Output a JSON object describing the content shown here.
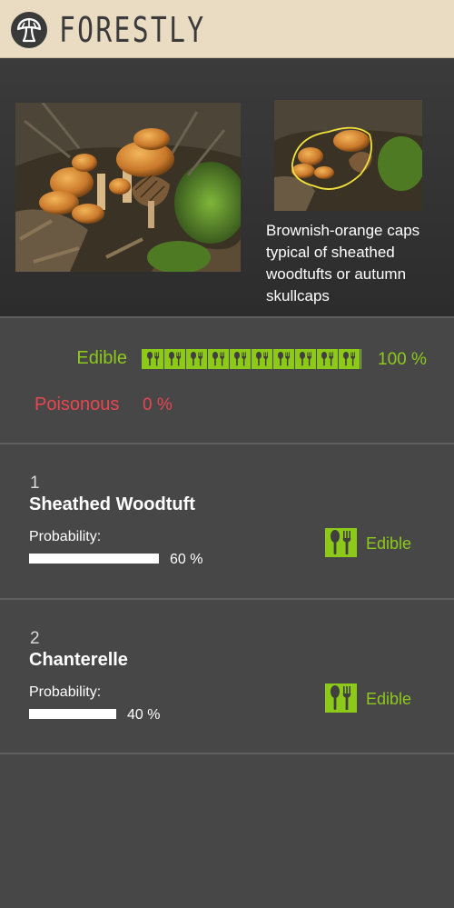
{
  "app": {
    "brand": "FORESTLY",
    "logo_icon": "mushroom-logo-icon"
  },
  "photo": {
    "caption": "Brownish-orange caps typical of sheathed woodtufts or autumn skullcaps"
  },
  "edibility": {
    "edible_label": "Edible",
    "edible_percent": 100,
    "edible_percent_text": "100 %",
    "poisonous_label": "Poisonous",
    "poisonous_percent": 0,
    "poisonous_percent_text": "0 %",
    "icon": "fork-spoon-icon",
    "colors": {
      "edible": "#8dc919",
      "poisonous": "#e84650"
    }
  },
  "results": [
    {
      "rank": "1",
      "name": "Sheathed Woodtuft",
      "probability_label": "Probability:",
      "probability": 0.6,
      "probability_text": "60 %",
      "edibility_label": "Edible",
      "icon": "fork-spoon-icon"
    },
    {
      "rank": "2",
      "name": "Chanterelle",
      "probability_label": "Probability:",
      "probability": 0.4,
      "probability_text": "40 %",
      "edibility_label": "Edible",
      "icon": "fork-spoon-icon"
    }
  ]
}
